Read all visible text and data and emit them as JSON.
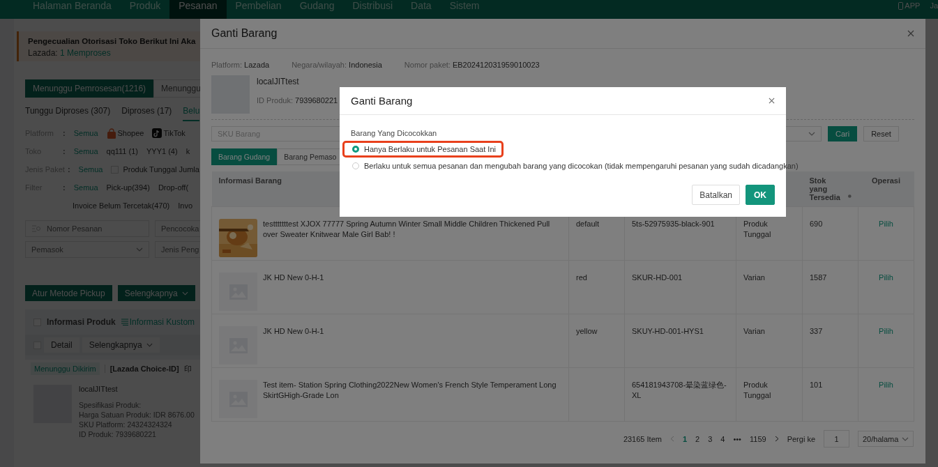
{
  "nav": {
    "items": [
      {
        "label": "Halaman Beranda",
        "selected": false
      },
      {
        "label": "Produk",
        "selected": false
      },
      {
        "label": "Pesanan",
        "selected": true
      },
      {
        "label": "Pembelian",
        "selected": false
      },
      {
        "label": "Gudang",
        "selected": false
      },
      {
        "label": "Distribusi",
        "selected": false
      },
      {
        "label": "Data",
        "selected": false
      },
      {
        "label": "Sistem",
        "selected": false
      }
    ],
    "app_label": "APP",
    "user": "Ja"
  },
  "page": {
    "notice": {
      "title": "Pengecualian Otorisasi Toko Berikut Ini Aka",
      "platform": "Lazada:",
      "count": "1",
      "status": "Memproses"
    },
    "status_tabs": [
      {
        "label": "Menunggu Pemrosesan(1216)",
        "selected": true
      },
      {
        "label": "Menunggu",
        "selected": false
      }
    ],
    "sub_tabs": [
      {
        "label": "Tunggu Diproses (307)",
        "selected": false
      },
      {
        "label": "Diproses (17)",
        "selected": false
      },
      {
        "label": "Belu",
        "selected": true
      }
    ],
    "filters": [
      {
        "label": "Platform",
        "colon": ":",
        "options": [
          {
            "kind": "text",
            "label": "Semua",
            "selected": true
          },
          {
            "kind": "bag",
            "label": "Shopee",
            "selected": false
          },
          {
            "kind": "note",
            "label": "TikTok",
            "selected": false
          }
        ]
      },
      {
        "label": "Toko",
        "colon": ":",
        "options": [
          {
            "kind": "text",
            "label": "Semua",
            "selected": true
          },
          {
            "kind": "text",
            "label": "qq111 (1)",
            "selected": false
          },
          {
            "kind": "text",
            "label": "YYY1 (4)",
            "selected": false
          },
          {
            "kind": "text",
            "label": "k",
            "selected": false
          }
        ]
      },
      {
        "label": "Jenis Paket",
        "colon": ":",
        "options": [
          {
            "kind": "text",
            "label": "Semua",
            "selected": true
          },
          {
            "kind": "checkbox",
            "label": "Produk Tunggal Jumla",
            "checked": false
          }
        ]
      },
      {
        "label": "Filter",
        "colon": ":",
        "options": [
          {
            "kind": "text",
            "label": "Semua",
            "selected": true
          },
          {
            "kind": "text",
            "label": "Pick-up(394)",
            "selected": false
          },
          {
            "kind": "text",
            "label": "Drop-off(",
            "selected": false
          }
        ]
      },
      {
        "options": [
          {
            "kind": "text",
            "label": "Invoice Belum Tercetak(470)",
            "selected": false
          },
          {
            "kind": "text",
            "label": "Invo",
            "selected": false
          }
        ]
      }
    ],
    "search_fields": [
      {
        "placeholder": "Nomor Pesanan"
      },
      {
        "placeholder": "Pencocoka"
      }
    ],
    "selects": [
      {
        "placeholder": "Pemasok"
      },
      {
        "placeholder": "Jenis Peng"
      }
    ],
    "actions": [
      "Atur Metode Pickup",
      "Selengkapnya"
    ],
    "list_header": {
      "checked": false,
      "label": "Informasi Produk",
      "custom": "Informasi Kustom"
    },
    "toolbar": {
      "checked": false,
      "buttons": [
        "Detail",
        "Selengkapnya"
      ]
    },
    "order": {
      "status": "Menunggu Dikirim",
      "store": "[Lazada Choice-ID]",
      "extra": "印",
      "product": "localJITtest",
      "lines": [
        "Spesifikasi Produk:",
        "Harga Satuan Produk:  IDR 8676.00",
        "SKU Platform:  24324324324",
        "ID Produk:  7939680221"
      ]
    }
  },
  "modal": {
    "title": "Ganti Barang",
    "info": [
      {
        "label": "Platform:",
        "value": "Lazada"
      },
      {
        "label": "Negara/wilayah:",
        "value": "Indonesia"
      },
      {
        "label": "Nomor paket:",
        "value": "EB202412031959010023"
      }
    ],
    "product": {
      "name": "localJITtest",
      "id_label": "ID Produk:",
      "id_value": "7939680221"
    },
    "search": {
      "placeholder": "SKU Barang"
    },
    "buttons": [
      "Cari",
      "Reset"
    ],
    "tabs": [
      {
        "label": "Barang Gudang",
        "selected": true
      },
      {
        "label": "Barang Pemaso",
        "selected": false
      }
    ],
    "columns": {
      "info": "Informasi Barang",
      "stock": "Stok yang Tersedia",
      "action": "Operasi"
    },
    "rows": [
      {
        "kind": "picture",
        "name": "testttttttest XJOX 77777 Spring Autumn Winter Small Middle Children Thickened Pull over Sweater Knitwear Male Girl Bab!  !",
        "column_2": "default",
        "column_3": "5ts-52975935-black-901",
        "column_4": "Produk Tunggal",
        "stock": "690",
        "action": "Pilih"
      },
      {
        "kind": "placeholder",
        "name": "JK HD New 0-H-1",
        "column_2": "red",
        "column_3": "SKUR-HD-001",
        "column_4": "Varian",
        "stock": "1587",
        "action": "Pilih"
      },
      {
        "kind": "placeholder",
        "name": "JK HD New 0-H-1",
        "column_2": "yellow",
        "column_3": "SKUY-HD-001-HYS1",
        "column_4": "Varian",
        "stock": "337",
        "action": "Pilih"
      },
      {
        "kind": "placeholder",
        "name": "Test item- Station Spring Clothing2022New Women's French Style Temperament Long SkirtGHigh-Grade Lon",
        "column_3": "654181943708-晕染蓝绿色-XL",
        "column_4": "Produk Tunggal",
        "stock": "101",
        "action": "Pilih"
      }
    ],
    "pagination": {
      "total": "23165 Item",
      "pages": [
        {
          "label": "1",
          "selected": true
        },
        {
          "label": "2",
          "selected": false
        },
        {
          "label": "3",
          "selected": false
        },
        {
          "label": "4",
          "selected": false
        }
      ],
      "ellipsis": "•••",
      "last": "1159",
      "goto_label": "Pergi ke",
      "goto_value": "1",
      "page_size": "20/halama"
    }
  },
  "dialog": {
    "title": "Ganti Barang",
    "label": "Barang Yang Dicocokkan",
    "options": [
      {
        "label": "Hanya Berlaku untuk Pesanan Saat Ini",
        "selected": true,
        "highlighted": true
      },
      {
        "label": "Berlaku untuk semua pesanan dan mengubah barang yang dicocokan (tidak mempengaruhi pesanan yang sudah dicadangkan)",
        "selected": false,
        "highlighted": false
      }
    ],
    "buttons": {
      "cancel": "Batalkan",
      "ok": "OK"
    }
  }
}
